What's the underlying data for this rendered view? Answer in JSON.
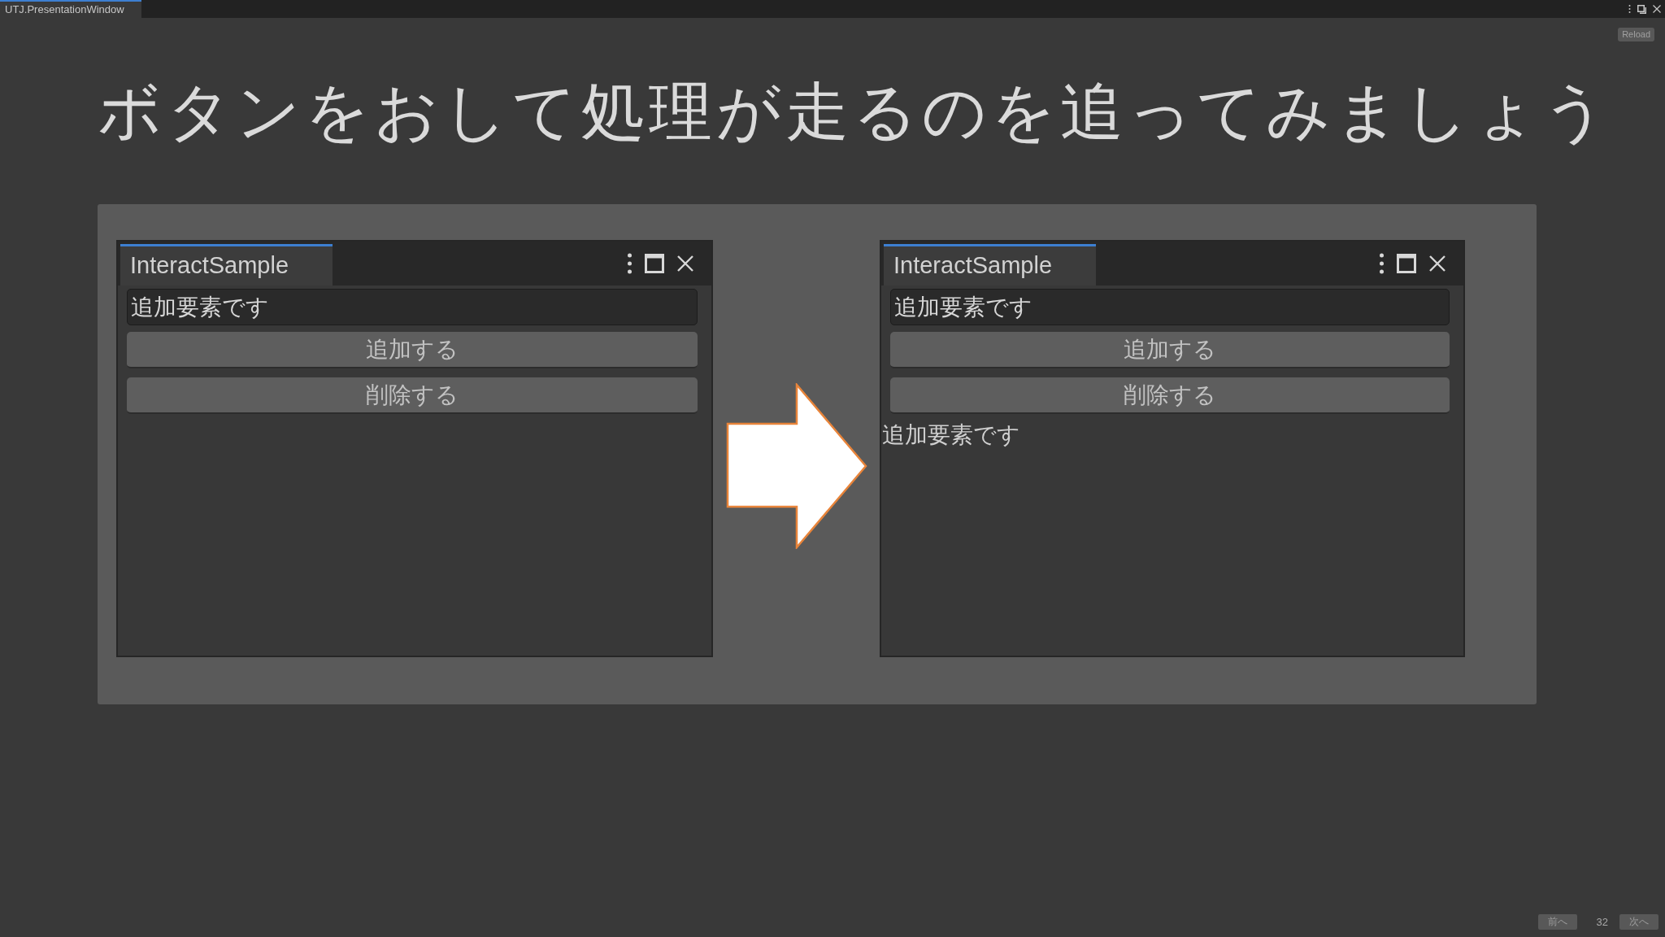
{
  "window": {
    "tab": {
      "title": "UTJ.PresentationWindow",
      "selected": true
    }
  },
  "toolbar": {
    "reload_button": "Reload"
  },
  "slide": {
    "title": "ボタンをおして処理が走るのを追ってみましょう",
    "panels": [
      {
        "tab": {
          "title": "InteractSample",
          "selected": true
        },
        "text_field": {
          "value": "追加要素です"
        },
        "buttons": [
          "追加する",
          "削除する"
        ]
      },
      {
        "tab": {
          "title": "InteractSample",
          "selected": true
        },
        "text_field": {
          "value": "追加要素です"
        },
        "buttons": [
          "追加する",
          "削除する"
        ],
        "added_labels": [
          "追加要素です"
        ]
      }
    ]
  },
  "navigation": {
    "prev_button": "前へ",
    "page": "32",
    "next_button": "次へ"
  }
}
